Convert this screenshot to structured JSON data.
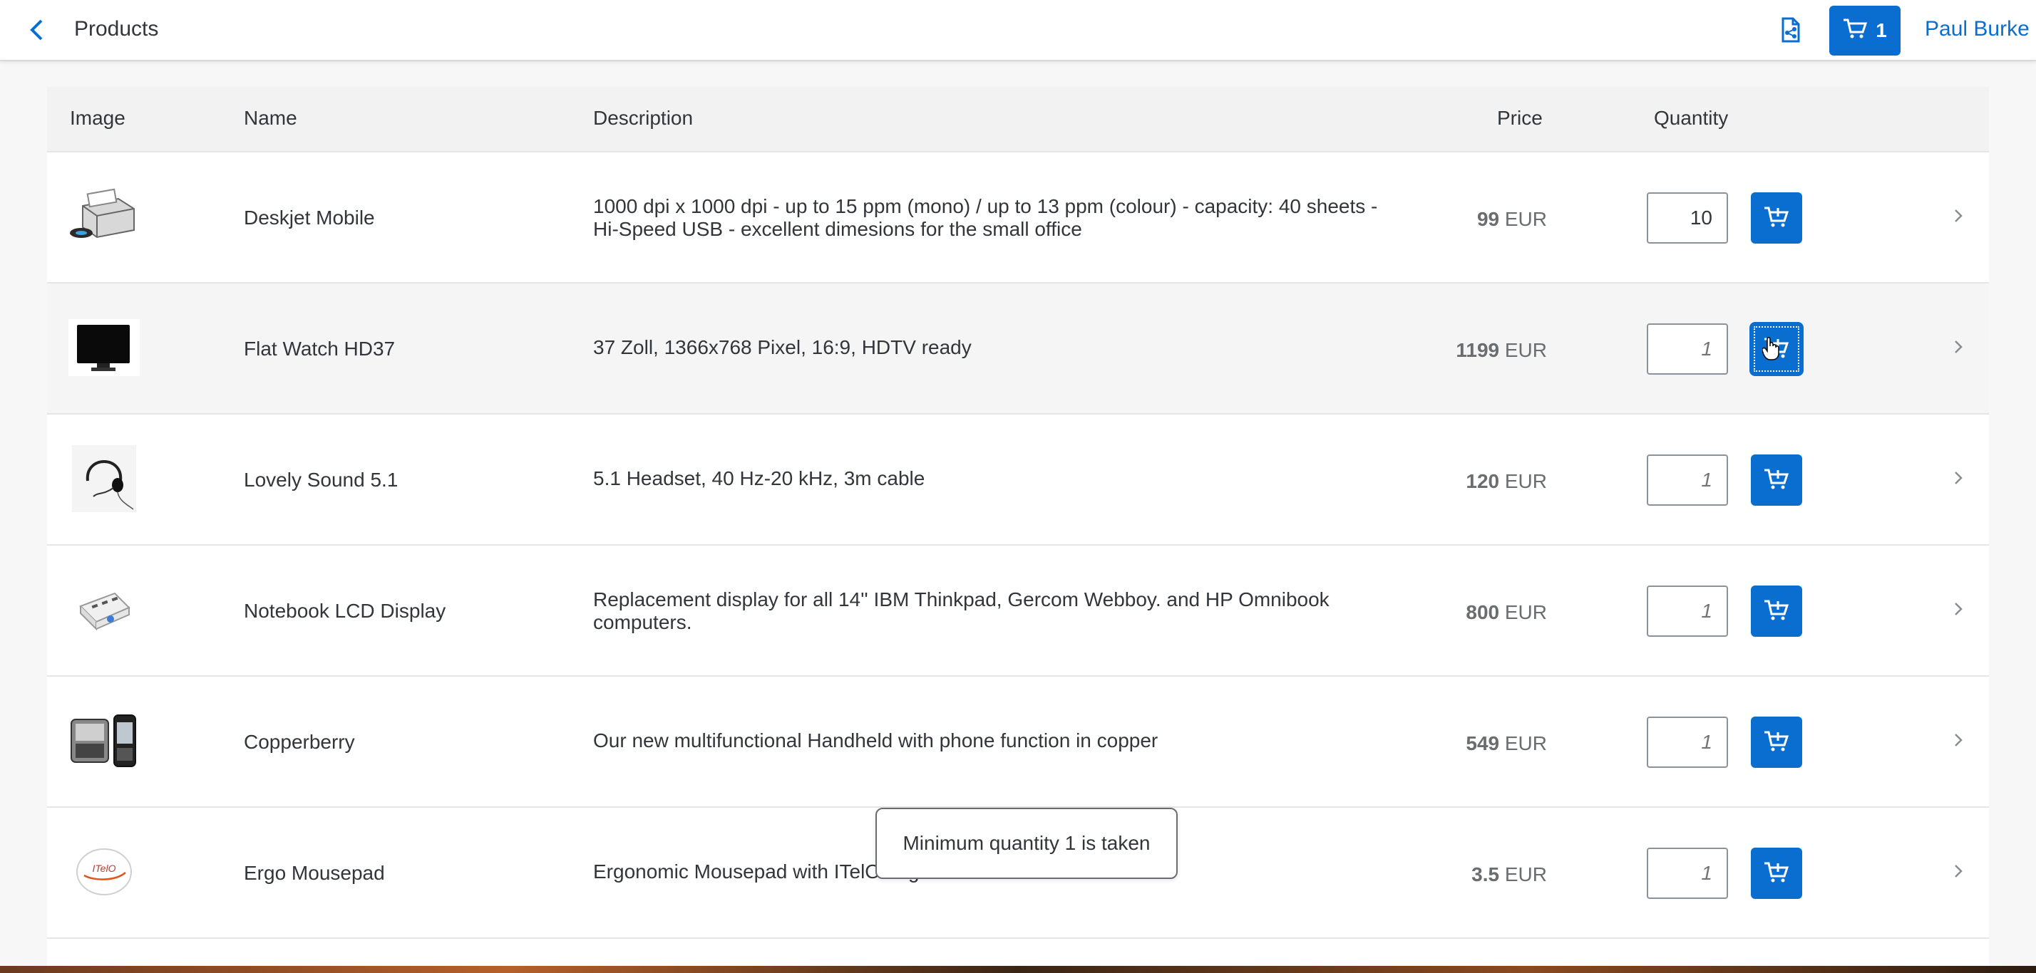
{
  "header": {
    "title": "Products",
    "cart_count": "1",
    "user_name": "Paul Burke",
    "icons": {
      "back": "chevron-left-icon",
      "share": "document-share-icon",
      "cart": "cart-icon"
    }
  },
  "table": {
    "columns": {
      "image": "Image",
      "name": "Name",
      "description": "Description",
      "price": "Price",
      "quantity": "Quantity"
    },
    "rows": [
      {
        "name": "Deskjet Mobile",
        "description": "1000 dpi x 1000 dpi - up to 15 ppm (mono) / up to 13 ppm (colour) - capacity: 40 sheets - Hi-Speed USB - excellent dimesions for the small office",
        "price": "99",
        "currency": "EUR",
        "quantity": "10",
        "quantity_placeholder": "",
        "image_icon": "printer-icon"
      },
      {
        "name": "Flat Watch HD37",
        "description": "37 Zoll, 1366x768 Pixel, 16:9, HDTV ready",
        "price": "1199",
        "currency": "EUR",
        "quantity": "",
        "quantity_placeholder": "1",
        "image_icon": "monitor-icon"
      },
      {
        "name": "Lovely Sound 5.1",
        "description": "5.1 Headset, 40 Hz-20 kHz, 3m cable",
        "price": "120",
        "currency": "EUR",
        "quantity": "",
        "quantity_placeholder": "1",
        "image_icon": "headset-icon"
      },
      {
        "name": "Notebook LCD Display",
        "description": "Replacement display for all 14'' IBM Thinkpad, Gercom Webboy. and HP Omnibook computers.",
        "price": "800",
        "currency": "EUR",
        "quantity": "",
        "quantity_placeholder": "1",
        "image_icon": "usb-hub-icon"
      },
      {
        "name": "Copperberry",
        "description": "Our new multifunctional Handheld with phone function in copper",
        "price": "549",
        "currency": "EUR",
        "quantity": "",
        "quantity_placeholder": "1",
        "image_icon": "handheld-phone-icon"
      },
      {
        "name": "Ergo Mousepad",
        "description": "Ergonomic Mousepad with ITelO Logo",
        "price": "3.5",
        "currency": "EUR",
        "quantity": "",
        "quantity_placeholder": "1",
        "image_icon": "mousepad-logo-icon",
        "logo_text": "ITelO"
      }
    ]
  },
  "tooltip": {
    "text": "Minimum quantity 1 is taken"
  },
  "colors": {
    "accent": "#0a6ed1",
    "header_bg": "#ffffff",
    "table_header_bg": "#f2f2f2",
    "hover_row": "#f5f5f5"
  }
}
